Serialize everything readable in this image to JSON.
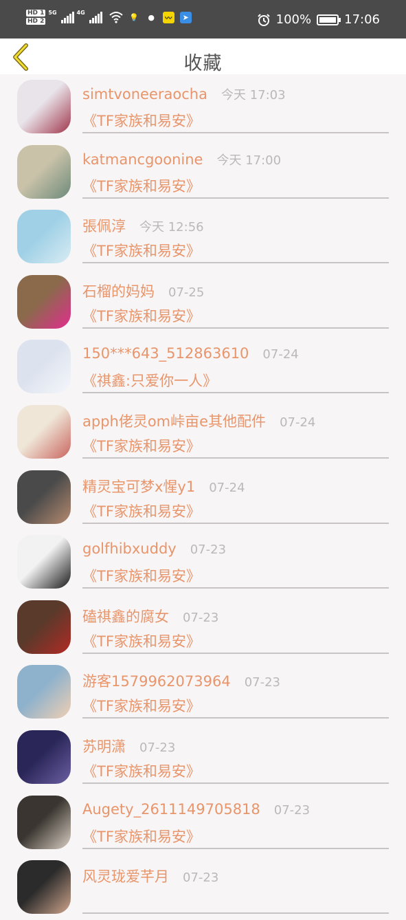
{
  "status": {
    "hd1": "HD 1",
    "hd2": "HD 2",
    "net1": "5G",
    "net2": "4G",
    "battery_pct": "100%",
    "time": "17:06"
  },
  "header": {
    "title": "收藏"
  },
  "favorites": [
    {
      "name": "simtvoneeraocha",
      "time": "今天 17:03",
      "song": "《TF家族和易安》",
      "avatar_colors": [
        "#e9e4ea",
        "#a0364b"
      ]
    },
    {
      "name": "katmancgoonine",
      "time": "今天 17:00",
      "song": "《TF家族和易安》",
      "avatar_colors": [
        "#c9c2a9",
        "#6d8a7a"
      ]
    },
    {
      "name": "張佩淳",
      "time": "今天 12:56",
      "song": "《TF家族和易安》",
      "avatar_colors": [
        "#9fd0e6",
        "#d8ecf3"
      ]
    },
    {
      "name": "石榴的妈妈",
      "time": "07-25",
      "song": "《TF家族和易安》",
      "avatar_colors": [
        "#8a6a4b",
        "#e22d8e"
      ]
    },
    {
      "name": "150***643_512863610",
      "time": "07-24",
      "song": "《祺鑫:只爱你一人》",
      "avatar_colors": [
        "#dce2ee",
        "#f4f6fa"
      ]
    },
    {
      "name": "apph佬灵om峠亩e其他配件",
      "time": "07-24",
      "song": "《TF家族和易安》",
      "avatar_colors": [
        "#efe6d7",
        "#c9655f"
      ]
    },
    {
      "name": "精灵宝可梦x惺y1",
      "time": "07-24",
      "song": "《TF家族和易安》",
      "avatar_colors": [
        "#4a4a4a",
        "#b68a6f"
      ]
    },
    {
      "name": "golfhibxuddy",
      "time": "07-23",
      "song": "《TF家族和易安》",
      "avatar_colors": [
        "#f2f2f2",
        "#1b1b1b"
      ]
    },
    {
      "name": "磕祺鑫的腐女",
      "time": "07-23",
      "song": "《TF家族和易安》",
      "avatar_colors": [
        "#5a3a2b",
        "#b22a25"
      ]
    },
    {
      "name": "游客1579962073964",
      "time": "07-23",
      "song": "《TF家族和易安》",
      "avatar_colors": [
        "#8fb2cc",
        "#f0cfb3"
      ]
    },
    {
      "name": "苏明潇",
      "time": "07-23",
      "song": "《TF家族和易安》",
      "avatar_colors": [
        "#2a2658",
        "#6b5fa3"
      ]
    },
    {
      "name": "Augety_2611149705818",
      "time": "07-23",
      "song": "《TF家族和易安》",
      "avatar_colors": [
        "#3a3530",
        "#d9cfc3"
      ]
    },
    {
      "name": "风灵珑爱芊月",
      "time": "07-23",
      "song": "",
      "avatar_colors": [
        "#2b2b2b",
        "#cfa58c"
      ]
    }
  ],
  "icons": {
    "back": "chevron-left-icon",
    "alarm": "alarm-icon",
    "wifi": "wifi-icon"
  }
}
